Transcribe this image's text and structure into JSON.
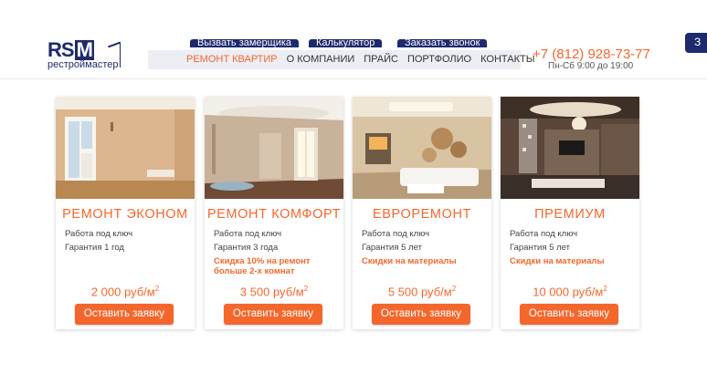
{
  "logo": {
    "mark_rs": "RS",
    "mark_m": "M",
    "subtitle": "рестроймастер"
  },
  "top_links": [
    {
      "label": "Вызвать замерщика"
    },
    {
      "label": "Калькулятор"
    },
    {
      "label": "Заказать звонок"
    }
  ],
  "nav": {
    "items": [
      {
        "label": "РЕМОНТ КВАРТИР",
        "active": true
      },
      {
        "label": "О КОМПАНИИ",
        "active": false
      },
      {
        "label": "ПРАЙС",
        "active": false
      },
      {
        "label": "ПОРТФОЛИО",
        "active": false
      },
      {
        "label": "КОНТАКТЫ",
        "active": false
      }
    ]
  },
  "contact": {
    "phone": "+7 (812) 928-73-77",
    "hours": "Пн-Сб 9:00 до 19:00"
  },
  "side_button": {
    "label": "З"
  },
  "cards": [
    {
      "title": "РЕМОНТ ЭКОНОМ",
      "line1": "Работа под ключ",
      "line2": "Гарантия 1 год",
      "promo": "",
      "price": "2 000 руб/м",
      "price_sup": "2",
      "button": "Оставить заявку"
    },
    {
      "title": "РЕМОНТ КОМФОРТ",
      "line1": "Работа под ключ",
      "line2": "Гарантия 3 года",
      "promo": "Скидка 10% на ремонт больше 2-х комнат",
      "price": "3 500 руб/м",
      "price_sup": "2",
      "button": "Оставить заявку"
    },
    {
      "title": "ЕВРОРЕМОНТ",
      "line1": "Работа под ключ",
      "line2": "Гарантия 5 лет",
      "promo": "Скидки на материалы",
      "price": "5 500 руб/м",
      "price_sup": "2",
      "button": "Оставить заявку"
    },
    {
      "title": "ПРЕМИУМ",
      "line1": "Работа под ключ",
      "line2": "Гарантия 5 лет",
      "promo": "Скидки на материалы",
      "price": "10 000 руб/м",
      "price_sup": "2",
      "button": "Оставить заявку"
    }
  ],
  "colors": {
    "accent": "#f4672c",
    "brand": "#1d2a6e",
    "nav_bg": "#eceef3"
  }
}
